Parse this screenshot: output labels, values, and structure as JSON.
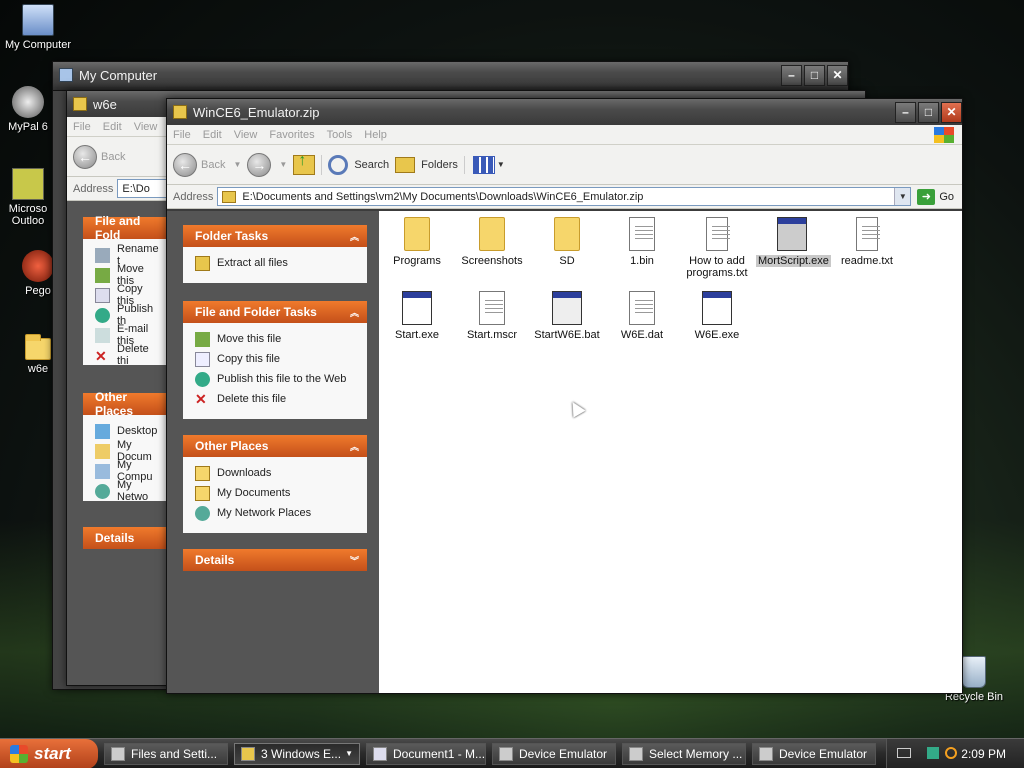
{
  "desktop": {
    "icons": [
      {
        "label": "My Computer"
      },
      {
        "label": "MyPal 6"
      },
      {
        "label": "Microso Outloo"
      },
      {
        "label": "Pego"
      },
      {
        "label": "w6e"
      },
      {
        "label": "Recycle Bin"
      }
    ]
  },
  "bg_window1": {
    "title": "My Computer"
  },
  "bg_window2": {
    "title": "w6e",
    "menu": [
      "File",
      "Edit",
      "View"
    ],
    "back_label": "Back",
    "address_label": "Address",
    "address_value": "E:\\Do",
    "panel1_title": "File and Fold",
    "panel1_items": [
      "Rename t",
      "Move this",
      "Copy this",
      "Publish th",
      "E-mail this",
      "Delete thi"
    ],
    "panel2_title": "Other Places",
    "panel2_items": [
      "Desktop",
      "My Docum",
      "My Compu",
      "My Netwo"
    ],
    "panel3_title": "Details"
  },
  "main_window": {
    "title": "WinCE6_Emulator.zip",
    "menu": [
      "File",
      "Edit",
      "View",
      "Favorites",
      "Tools",
      "Help"
    ],
    "toolbar": {
      "back": "Back",
      "search": "Search",
      "folders": "Folders"
    },
    "address_label": "Address",
    "address_value": "E:\\Documents and Settings\\vm2\\My Documents\\Downloads\\WinCE6_Emulator.zip",
    "go_label": "Go",
    "sidebar": {
      "folder_tasks": {
        "title": "Folder Tasks",
        "items": [
          "Extract all files"
        ]
      },
      "file_tasks": {
        "title": "File and Folder Tasks",
        "items": [
          "Move this file",
          "Copy this file",
          "Publish this file to the Web",
          "Delete this file"
        ]
      },
      "other_places": {
        "title": "Other Places",
        "items": [
          "Downloads",
          "My Documents",
          "My Network Places"
        ]
      },
      "details": {
        "title": "Details"
      }
    },
    "files": [
      {
        "name": "Programs",
        "icon": "folder-icon"
      },
      {
        "name": "Screenshots",
        "icon": "folder-icon"
      },
      {
        "name": "SD",
        "icon": "folder-icon"
      },
      {
        "name": "1.bin",
        "icon": "binary-file-icon"
      },
      {
        "name": "How to add programs.txt",
        "icon": "text-file-icon"
      },
      {
        "name": "MortScript.exe",
        "icon": "app-icon"
      },
      {
        "name": "readme.txt",
        "icon": "text-file-icon"
      },
      {
        "name": "Start.exe",
        "icon": "app-icon"
      },
      {
        "name": "Start.mscr",
        "icon": "script-file-icon"
      },
      {
        "name": "StartW6E.bat",
        "icon": "batch-file-icon"
      },
      {
        "name": "W6E.dat",
        "icon": "data-file-icon"
      },
      {
        "name": "W6E.exe",
        "icon": "app-icon"
      }
    ]
  },
  "taskbar": {
    "start": "start",
    "tasks": [
      "Files and Setti...",
      "3 Windows E...",
      "Document1 - M...",
      "Device Emulator",
      "Select Memory ...",
      "Device Emulator"
    ],
    "clock": "2:09 PM"
  }
}
